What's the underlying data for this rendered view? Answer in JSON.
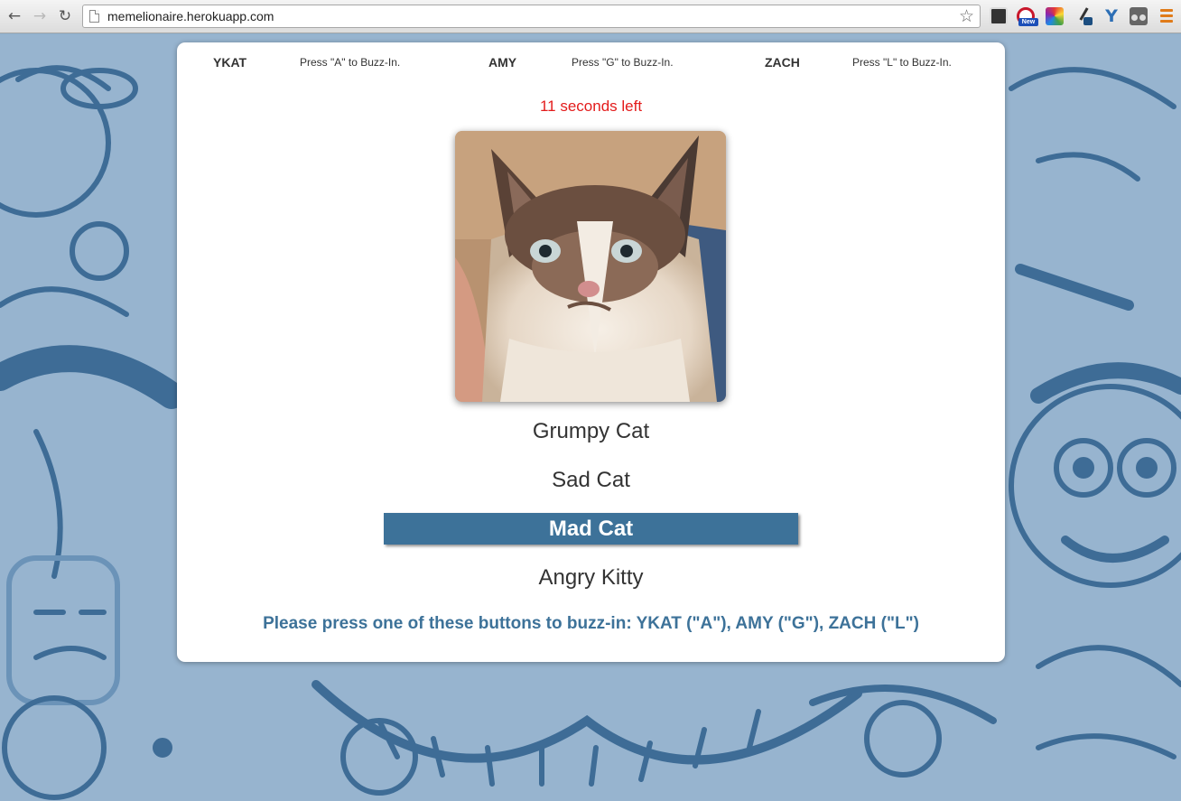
{
  "browser": {
    "url": "memelionaire.herokuapp.com",
    "back_icon": "back-arrow-icon",
    "forward_icon": "forward-arrow-icon",
    "reload_icon": "reload-icon",
    "bookmark_icon": "star-icon",
    "extension_badge": "New",
    "extensions": [
      "screen-capture-icon",
      "notification-icon",
      "color-picker-icon",
      "eyedropper-icon",
      "y-icon",
      "incognito-icon"
    ],
    "menu_icon": "hamburger-menu-icon"
  },
  "game": {
    "players": [
      {
        "name": "YKAT",
        "hint": "Press \"A\" to Buzz-In."
      },
      {
        "name": "AMY",
        "hint": "Press \"G\" to Buzz-In."
      },
      {
        "name": "ZACH",
        "hint": "Press \"L\" to Buzz-In."
      }
    ],
    "timer": "11 seconds left",
    "image": "grumpy-cat-photo",
    "options": [
      {
        "label": "Grumpy Cat",
        "selected": false
      },
      {
        "label": "Sad Cat",
        "selected": false
      },
      {
        "label": "Mad Cat",
        "selected": true
      },
      {
        "label": "Angry Kitty",
        "selected": false
      }
    ],
    "instructions": "Please press one of these buttons to buzz-in: YKAT (\"A\"), AMY (\"G\"), ZACH (\"L\")"
  },
  "colors": {
    "accent": "#3d7299",
    "timer": "#e31b1b",
    "background": "#97b4cf"
  }
}
